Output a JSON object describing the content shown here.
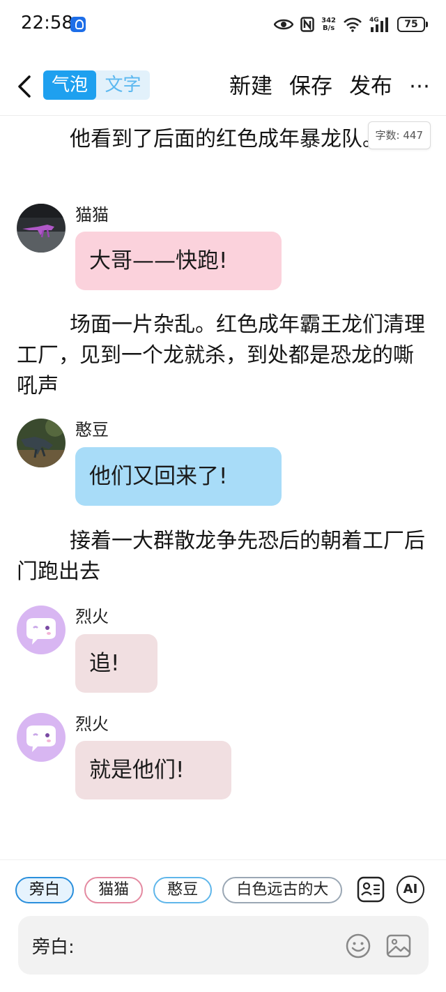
{
  "status_bar": {
    "time": "22:58",
    "speed_top": "342",
    "speed_bottom": "B/s",
    "network": "4G",
    "battery": "75"
  },
  "nav": {
    "mode_tabs": [
      "气泡",
      "文字"
    ],
    "active_mode": "气泡",
    "actions": [
      "新建",
      "保存",
      "发布"
    ],
    "more": "⋯"
  },
  "word_count": "字数: 447",
  "story": [
    {
      "kind": "narration",
      "text": "他看到了后面的红色成年暴龙队。"
    },
    {
      "kind": "message",
      "name": "猫猫",
      "text": "大哥——快跑!",
      "bubble_color": "#fbd2dc"
    },
    {
      "kind": "narration",
      "text": "场面一片杂乱。红色成年霸王龙们清理工厂，见到一个龙就杀，到处都是恐龙的嘶吼声"
    },
    {
      "kind": "message",
      "name": "憨豆",
      "text": "他们又回来了!",
      "bubble_color": "#a8dcf8"
    },
    {
      "kind": "narration",
      "text": "接着一大群散龙争先恐后的朝着工厂后门跑出去"
    },
    {
      "kind": "message",
      "name": "烈火",
      "text": "追!",
      "bubble_color": "#f1dfe1"
    },
    {
      "kind": "message",
      "name": "烈火",
      "text": "就是他们!",
      "bubble_color": "#f1dfe1"
    }
  ],
  "composer": {
    "roles": [
      "旁白",
      "猫猫",
      "憨豆",
      "白色远古的大"
    ],
    "selected_role": "旁白",
    "ai_label": "AI",
    "label": "旁白:",
    "input_value": ""
  },
  "colors": {
    "accent": "#1ea0ef",
    "ghost_avatar": "#d8b6f2"
  }
}
